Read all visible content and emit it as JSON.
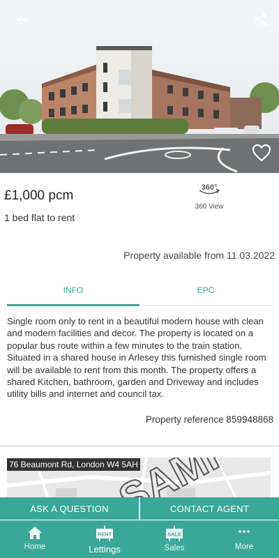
{
  "listing": {
    "price": "£1,000 pcm",
    "subtitle": "1 bed flat to rent",
    "view_360_label": "360 View",
    "view_360_badge": "360°",
    "available": "Property available from 11.03.2022",
    "description": "Single room only to rent in a beautiful modern house with clean and modern facilities and decor. The property is located on a popular bus route within a few minutes to the train station. Situated in a shared house in Arlesey this furnished single room will be available to rent from this month. The property offers a shared Kitchen, bathroom, garden and Driveway and includes utility bills and internet and council tax.",
    "reference": "Property reference 859948868"
  },
  "tabs": [
    {
      "label": "INFO",
      "active": true
    },
    {
      "label": "EPC",
      "active": false
    }
  ],
  "map": {
    "address": "76 Beaumont Rd, London W4 5AH",
    "watermark": "SAMPLE"
  },
  "actions": {
    "ask_question": "ASK A QUESTION",
    "contact_agent": "CONTACT AGENT"
  },
  "nav": [
    {
      "label": "Home",
      "icon": "home-icon",
      "active": false
    },
    {
      "label": "Lettings",
      "icon": "rent-sign-icon",
      "badge": "RENT",
      "active": true
    },
    {
      "label": "Sales",
      "icon": "sale-sign-icon",
      "badge": "SALE",
      "active": false
    },
    {
      "label": "More",
      "icon": "more-dots-icon",
      "active": false
    }
  ],
  "colors": {
    "accent": "#3aa898",
    "text": "#333333"
  }
}
